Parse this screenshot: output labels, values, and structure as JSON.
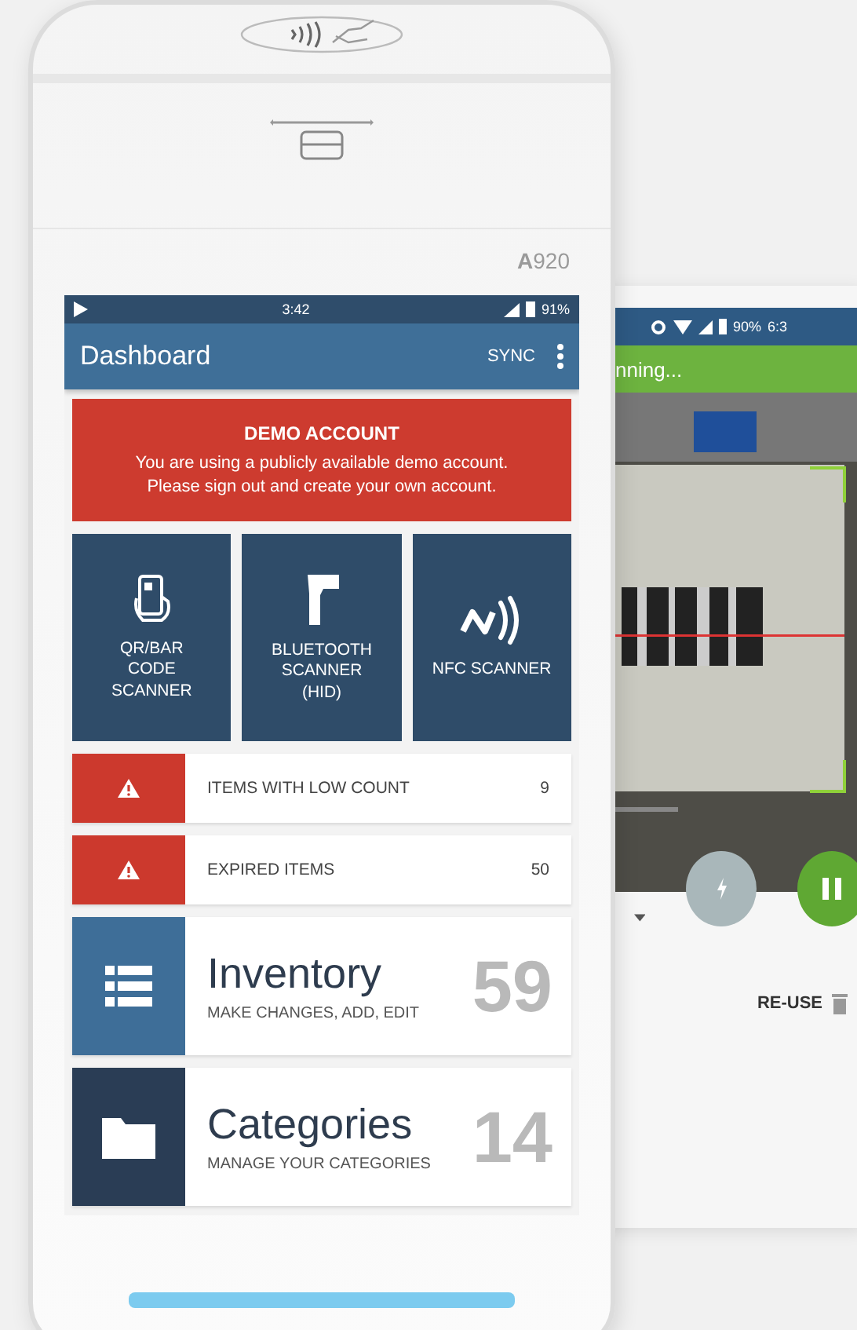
{
  "device": {
    "model": "**A**920"
  },
  "status_bar": {
    "time": "3:42",
    "battery": "91%"
  },
  "app_bar": {
    "title": "Dashboard",
    "action": "SYNC"
  },
  "banner": {
    "title": "DEMO ACCOUNT",
    "message": "You are using a publicly available demo account. Please sign out and create your own account."
  },
  "scanners": [
    {
      "kind": "qr",
      "label": "QR/BAR\nCODE\nSCANNER"
    },
    {
      "kind": "bluetooth",
      "label": "BLUETOOTH\nSCANNER\n(HID)"
    },
    {
      "kind": "nfc",
      "label": "NFC SCANNER"
    }
  ],
  "alerts": [
    {
      "label": "ITEMS WITH LOW COUNT",
      "count": "9"
    },
    {
      "label": "EXPIRED ITEMS",
      "count": "50"
    }
  ],
  "sections": [
    {
      "kind": "inventory",
      "title": "Inventory",
      "subtitle": "MAKE CHANGES, ADD, EDIT",
      "count": "59"
    },
    {
      "kind": "categories",
      "title": "Categories",
      "subtitle": "MANAGE YOUR CATEGORIES",
      "count": "14"
    }
  ],
  "second_phone": {
    "battery": "90%",
    "time": "6:3",
    "header": "nning...",
    "button": "RE-USE"
  }
}
